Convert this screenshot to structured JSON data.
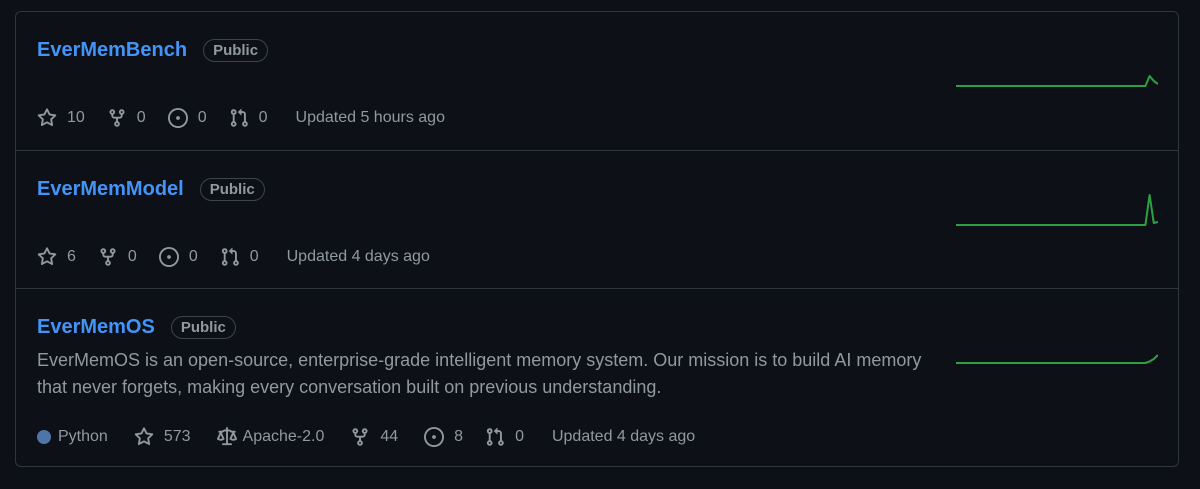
{
  "colors": {
    "link": "#4493f8",
    "python": "#3572A5",
    "spark": "#2ea043"
  },
  "repos": [
    {
      "name": "EverMemBench",
      "visibility": "Public",
      "description": "",
      "language": "",
      "license": "",
      "stars": "10",
      "forks": "0",
      "issues": "0",
      "prs": "0",
      "updated": "Updated 5 hours ago",
      "activity": [
        0,
        0,
        0,
        0,
        0,
        0,
        0,
        0,
        0,
        0,
        0,
        0,
        0,
        0,
        0,
        0,
        0,
        0,
        0,
        0,
        0,
        0,
        0,
        0,
        0,
        0,
        0,
        0,
        0,
        0,
        0,
        0,
        0,
        0,
        0,
        0,
        0,
        0,
        0,
        0,
        0,
        0,
        0,
        0,
        0,
        0,
        2,
        1,
        0.4
      ]
    },
    {
      "name": "EverMemModel",
      "visibility": "Public",
      "description": "",
      "language": "",
      "license": "",
      "stars": "6",
      "forks": "0",
      "issues": "0",
      "prs": "0",
      "updated": "Updated 4 days ago",
      "activity": [
        0,
        0,
        0,
        0,
        0,
        0,
        0,
        0,
        0,
        0,
        0,
        0,
        0,
        0,
        0,
        0,
        0,
        0,
        0,
        0,
        0,
        0,
        0,
        0,
        0,
        0,
        0,
        0,
        0,
        0,
        0,
        0,
        0,
        0,
        0,
        0,
        0,
        0,
        0,
        0,
        0,
        0,
        0,
        0,
        0,
        0,
        6,
        0.4,
        0.6
      ]
    },
    {
      "name": "EverMemOS",
      "visibility": "Public",
      "description": "EverMemOS is an open-source, enterprise-grade intelligent memory system. Our mission is to build AI memory that never forgets, making every conversation built on previous understanding.",
      "language": "Python",
      "license": "Apache-2.0",
      "stars": "573",
      "forks": "44",
      "issues": "8",
      "prs": "0",
      "updated": "Updated 4 days ago",
      "activity": [
        0,
        0,
        0,
        0,
        0,
        0,
        0,
        0,
        0,
        0,
        0,
        0,
        0,
        0,
        0,
        0,
        0,
        0,
        0,
        0,
        0,
        0,
        0,
        0,
        0,
        0,
        0,
        0,
        0,
        0,
        0,
        0,
        0,
        0,
        0,
        0,
        0,
        0,
        0,
        0,
        0,
        0,
        0,
        0,
        0,
        0,
        0.3,
        0.8,
        1.6
      ]
    }
  ]
}
